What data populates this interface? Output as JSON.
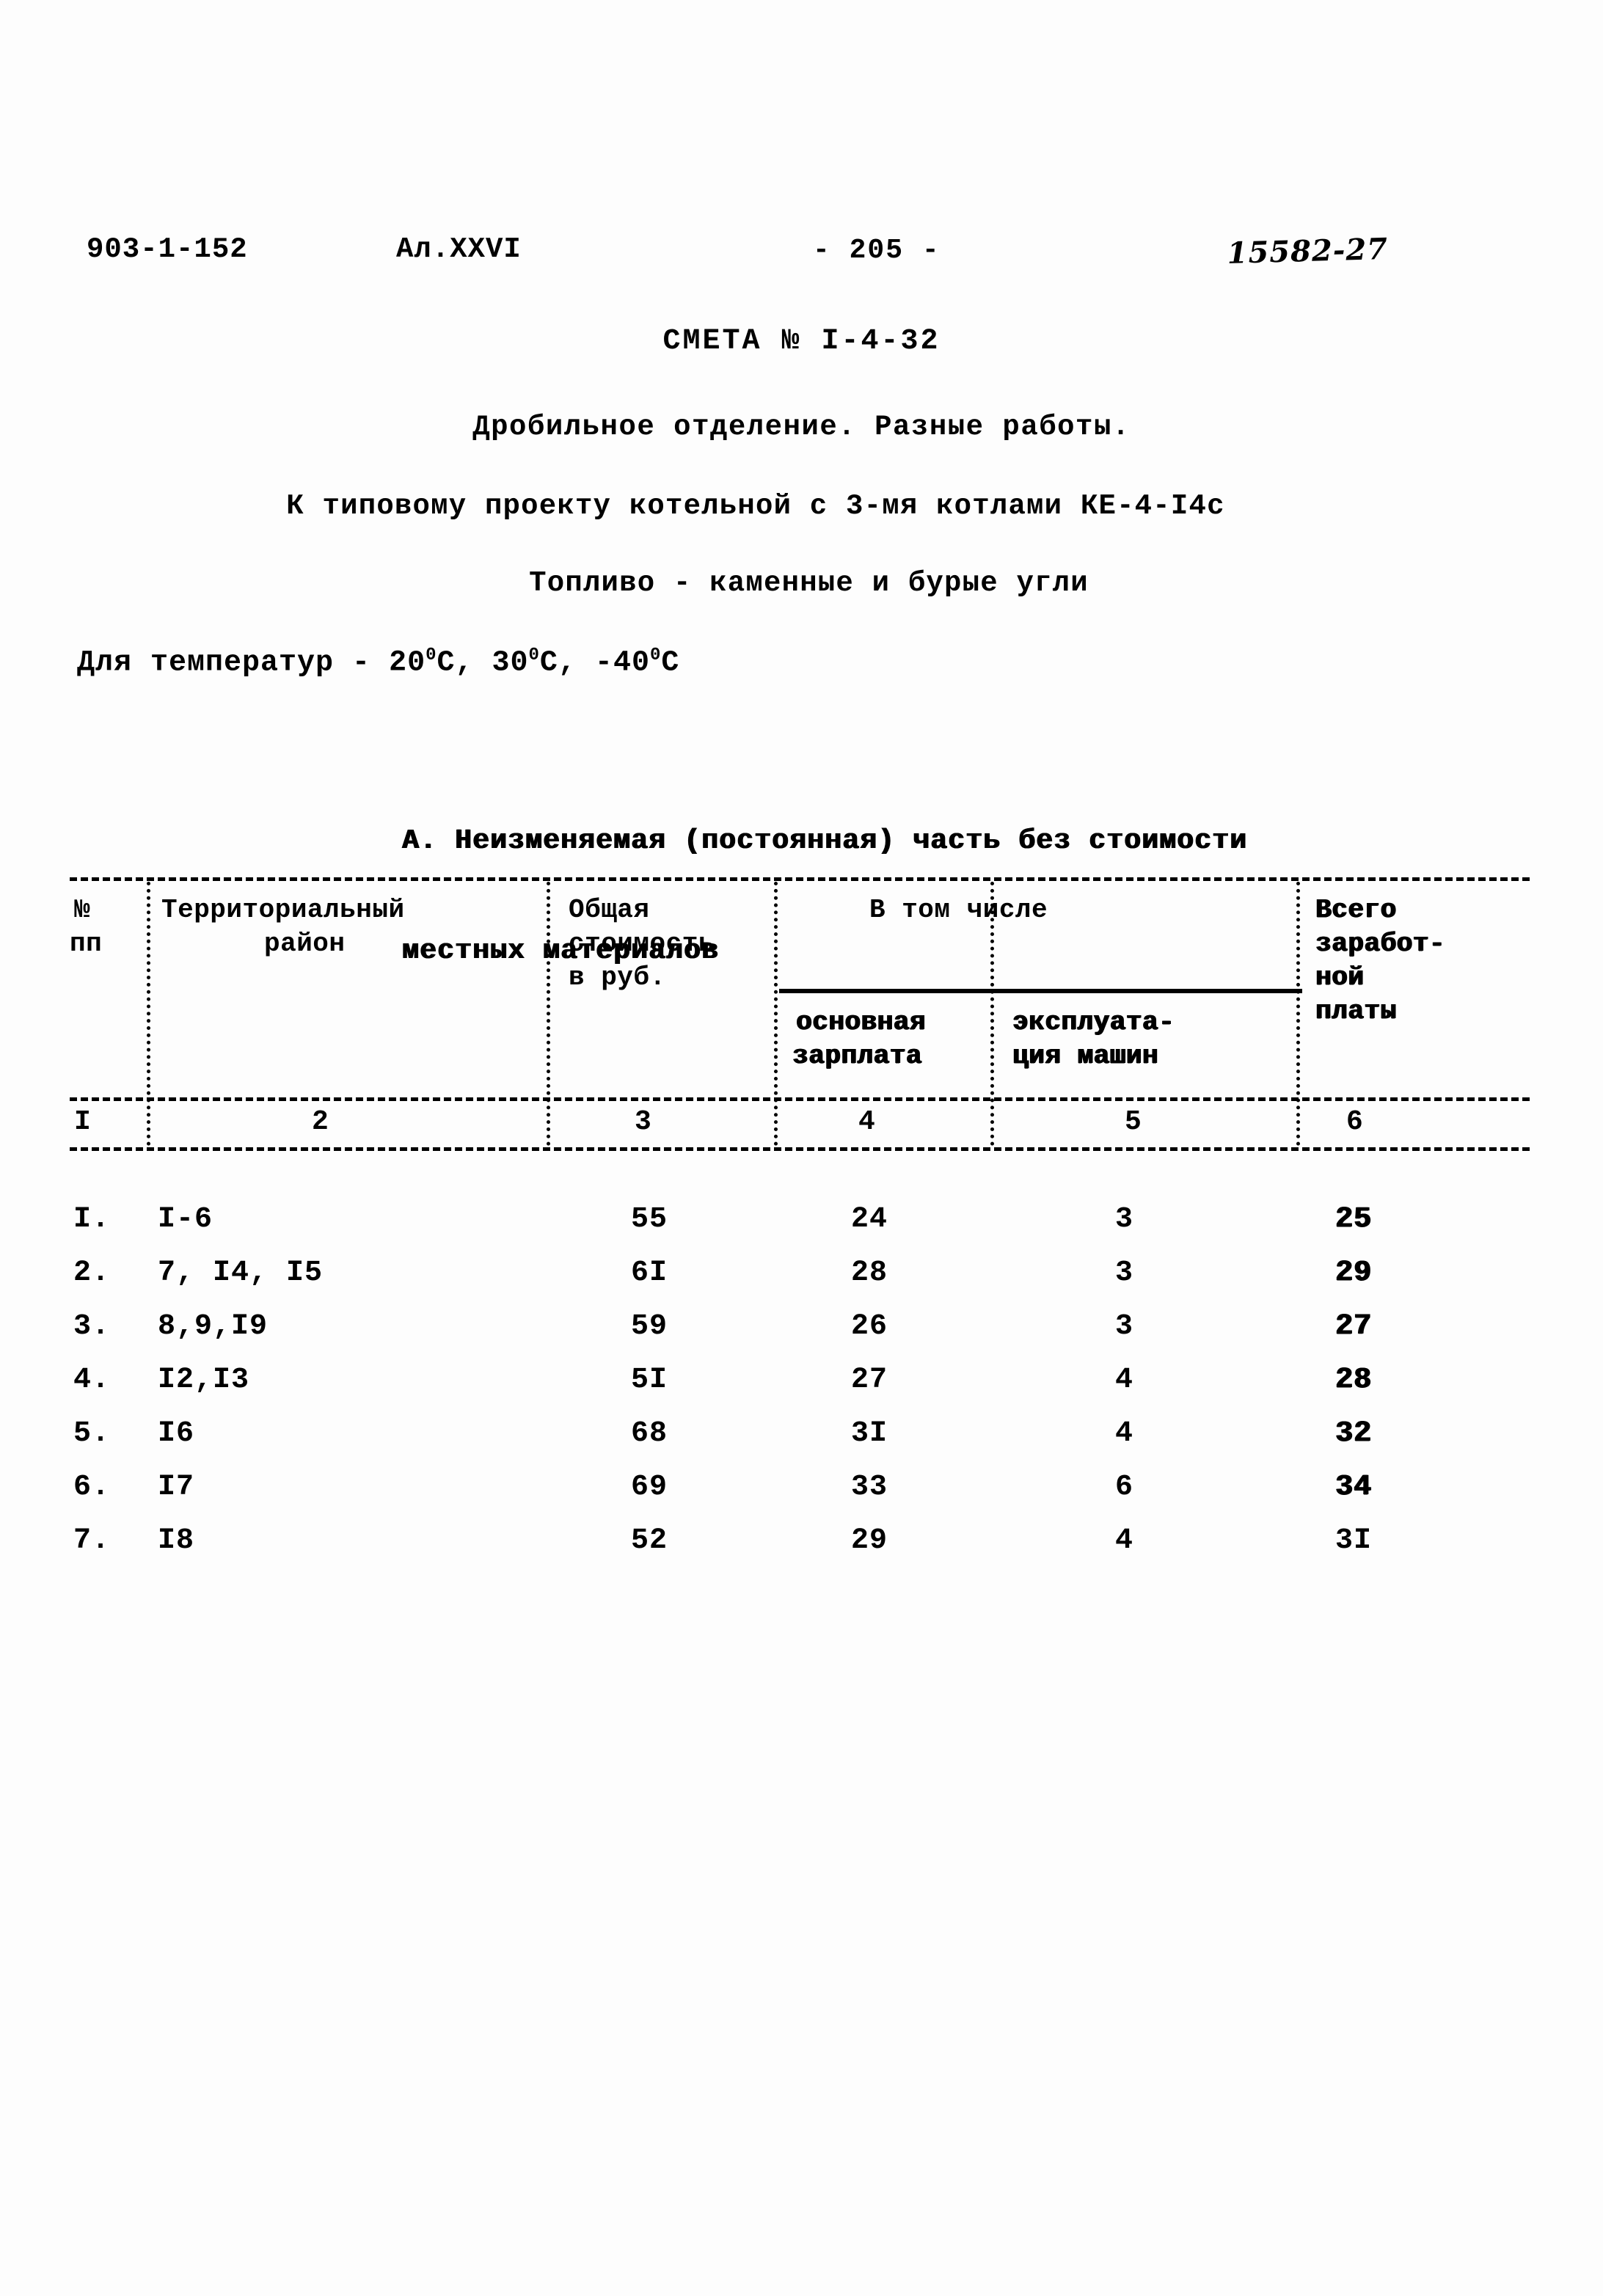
{
  "header": {
    "doc_code": "903-1-152",
    "album": "Ал.XXVI",
    "page_number": "- 205 -",
    "stamp_number": "15582-27"
  },
  "title": {
    "estimate": "СМЕТА № I-4-32",
    "line1": "Дробильное отделение. Разные работы.",
    "line2": "К типовому проекту котельной с 3-мя котлами КЕ-4-I4с",
    "line3": "Топливо - каменные и бурые угли",
    "temperature_prefix": "Для температур - 20",
    "temperature_mid1": "С, 30",
    "temperature_mid2": "С, -40",
    "temperature_suffix": "С",
    "degree": "0"
  },
  "section": {
    "label": "А. Неизменяемая (постоянная) часть без стоимости",
    "label2": "местных материалов"
  },
  "table": {
    "headers": {
      "no_line1": "№",
      "no_line2": "пп",
      "region_line1": "Территориальный",
      "region_line2": "район",
      "total_line1": "Общая",
      "total_line2": "стоимость",
      "total_line3": "в руб.",
      "group_title": "В том числе",
      "sub_zarplata_line1": "основная",
      "sub_zarplata_line2": "зарплата",
      "sub_eksp_line1": "эксплуата-",
      "sub_eksp_line2": "ция машин",
      "vsego_line1": "Всего",
      "vsego_line2": "заработ-",
      "vsego_line3": "ной",
      "vsego_line4": "платы"
    },
    "column_numbers": [
      "I",
      "2",
      "3",
      "4",
      "5",
      "6"
    ],
    "rows": [
      {
        "no": "I.",
        "region": "I-6",
        "total": "55",
        "zarplata": "24",
        "eksplutacia": "3",
        "vsego": "25"
      },
      {
        "no": "2.",
        "region": "7, I4, I5",
        "total": "6I",
        "zarplata": "28",
        "eksplutacia": "3",
        "vsego": "29"
      },
      {
        "no": "3.",
        "region": "8,9,I9",
        "total": "59",
        "zarplata": "26",
        "eksplutacia": "3",
        "vsego": "27"
      },
      {
        "no": "4.",
        "region": "I2,I3",
        "total": "5I",
        "zarplata": "27",
        "eksplutacia": "4",
        "vsego": "28"
      },
      {
        "no": "5.",
        "region": "I6",
        "total": "68",
        "zarplata": "3I",
        "eksplutacia": "4",
        "vsego": "32"
      },
      {
        "no": "6.",
        "region": "I7",
        "total": "69",
        "zarplata": "33",
        "eksplutacia": "6",
        "vsego": "34"
      },
      {
        "no": "7.",
        "region": "I8",
        "total": "52",
        "zarplata": "29",
        "eksplutacia": "4",
        "vsego": "3I"
      }
    ]
  }
}
